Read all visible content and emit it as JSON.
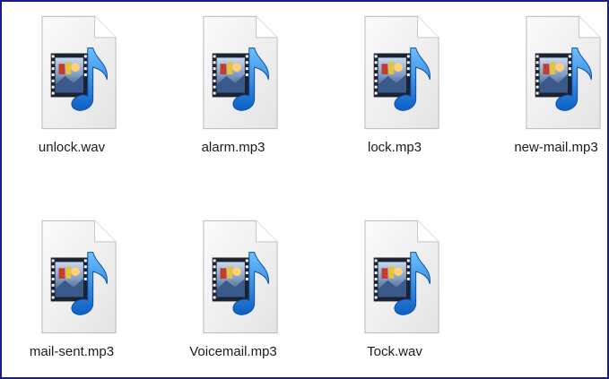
{
  "window": {
    "border_color": "#1a1a8c"
  },
  "files": [
    {
      "name": "unlock.wav",
      "icon": "audio-file-icon"
    },
    {
      "name": "alarm.mp3",
      "icon": "audio-file-icon"
    },
    {
      "name": "lock.mp3",
      "icon": "audio-file-icon"
    },
    {
      "name": "new-mail.mp3",
      "icon": "audio-file-icon"
    },
    {
      "name": "mail-sent.mp3",
      "icon": "audio-file-icon"
    },
    {
      "name": "Voicemail.mp3",
      "icon": "audio-file-icon"
    },
    {
      "name": "Tock.wav",
      "icon": "audio-file-icon"
    }
  ],
  "colors": {
    "note": "#1a6fd4",
    "film": "#1c2230",
    "page": "#f2f2f2"
  }
}
